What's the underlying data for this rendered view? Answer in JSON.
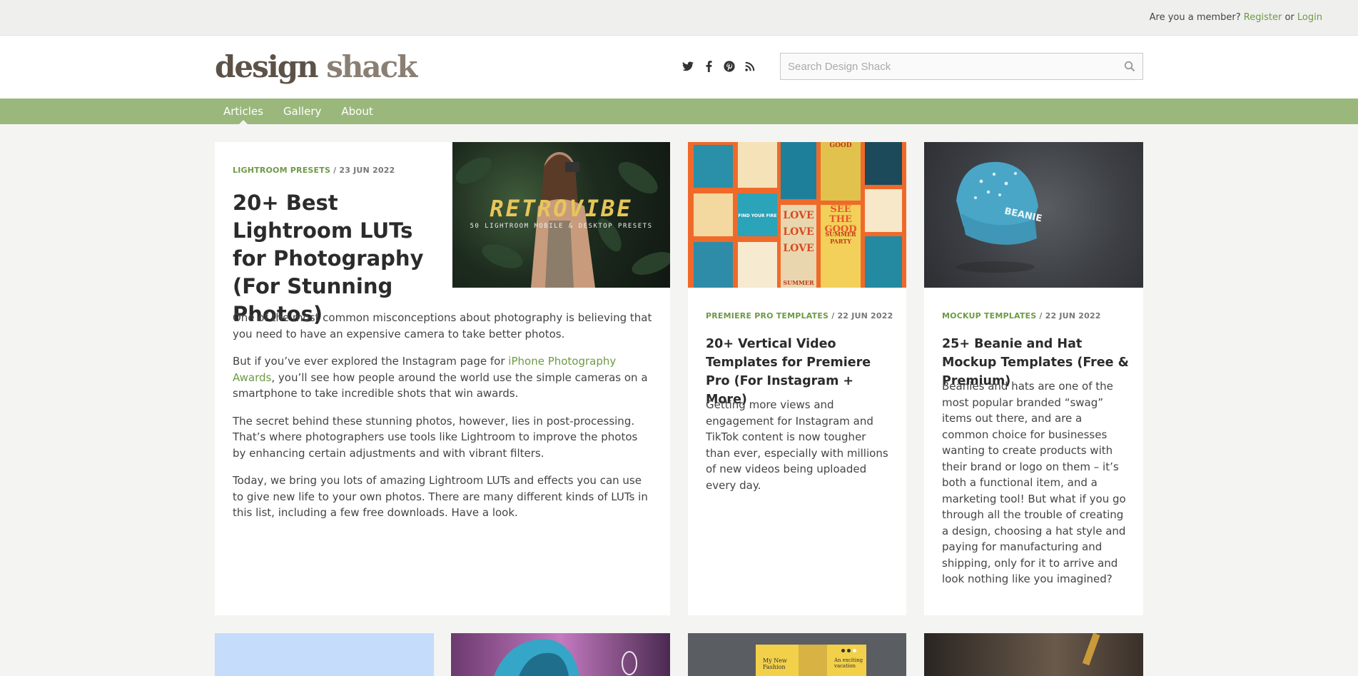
{
  "topbar": {
    "member_prompt": "Are you a member?",
    "register_label": "Register",
    "or_text": "or",
    "login_label": "Login"
  },
  "header": {
    "logo_part1": "design",
    "logo_part2": "shack",
    "social_icons": [
      "twitter-icon",
      "facebook-icon",
      "pinterest-icon",
      "rss-icon"
    ],
    "search_placeholder": "Search Design Shack"
  },
  "nav": {
    "items": [
      {
        "label": "Articles",
        "active": true
      },
      {
        "label": "Gallery",
        "active": false
      },
      {
        "label": "About",
        "active": false
      }
    ]
  },
  "featured": {
    "category": "Lightroom Presets",
    "date": "23 Jun 2022",
    "title": "20+ Best Lightroom LUTs for Photography (For Stunning Photos)",
    "image_title": "RETROVIBE",
    "image_subtitle": "50 LIGHTROOM MOBILE & DESKTOP PRESETS",
    "paragraphs": {
      "p1": "One of the most common misconceptions about photography is believing that you need to have an expensive camera to take better photos.",
      "p2_before": "But if you’ve ever explored the Instagram page for ",
      "p2_link": "iPhone Photography Awards",
      "p2_after": ", you’ll see how people around the world use the simple cameras on a smartphone to take incredible shots that win awards.",
      "p3": "The secret behind these stunning photos, however, lies in post-processing. That’s where photographers use tools like Lightroom to improve the photos by enhancing certain adjustments and with vibrant filters.",
      "p4": "Today, we bring you lots of amazing Lightroom LUTs and effects you can use to give new life to your own photos. There are many different kinds of LUTs in this list, including a few free downloads. Have a look."
    }
  },
  "cards": [
    {
      "category": "Premiere Pro Templates",
      "date": "22 Jun 2022",
      "title": "20+ Vertical Video Templates for Premiere Pro (For Instagram + More)",
      "excerpt": "Getting more views and engagement for Instagram and TikTok content is now tougher than ever, especially with millions of new videos being uploaded every day.",
      "image_texts": [
        "SEE THE GOOD",
        "LOVE",
        "LOVE",
        "LOVE",
        "SUMMER PARTY",
        "FIND YOUR FIRE",
        "GOOD",
        "SUMMER"
      ]
    },
    {
      "category": "Mockup Templates",
      "date": "22 Jun 2022",
      "title": "25+ Beanie and Hat Mockup Templates (Free & Premium)",
      "excerpt": "Beanies and hats are one of the most popular branded “swag” items out there, and are a common choice for businesses wanting to create products with their brand or logo on them – it’s both a functional item, and a marketing tool! But what if you go through all the trouble of creating a design, choosing a hat style and paying for manufacturing and shipping, only for it to arrive and look nothing like you imagined?",
      "image_text": "BEANIE"
    }
  ],
  "bottom_row": {
    "fashion_card_text": "My New Fashion",
    "fashion_card_text2": "An exciting vacation"
  },
  "colors": {
    "accent_green": "#6e9a46",
    "nav_green": "#9bb87c",
    "background": "#f4f4f3"
  }
}
